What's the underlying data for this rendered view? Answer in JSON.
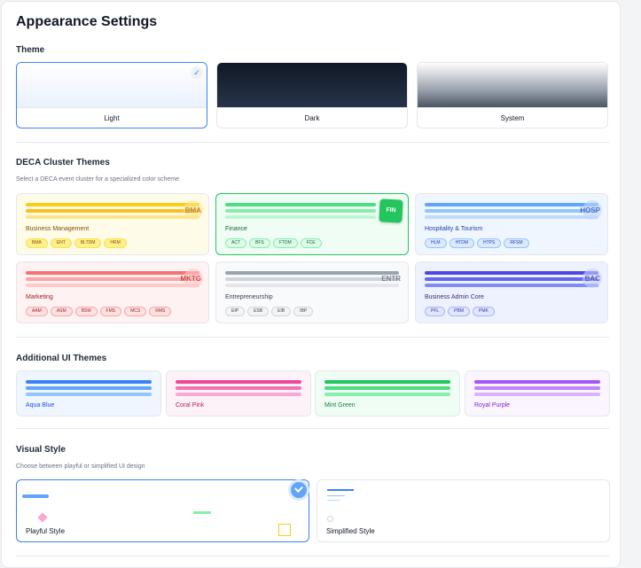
{
  "page": {
    "title": "Appearance Settings"
  },
  "theme": {
    "label": "Theme",
    "options": [
      {
        "label": "Light",
        "selected": true
      },
      {
        "label": "Dark",
        "selected": false
      },
      {
        "label": "System",
        "selected": false
      }
    ]
  },
  "clusters": {
    "label": "DECA Cluster Themes",
    "sub": "Select a DECA event cluster for a specialized color scheme",
    "items": [
      {
        "name": "Business Management",
        "abbr": "BMA",
        "tags": [
          "BMA",
          "ENT",
          "BLTDM",
          "HRM"
        ],
        "color": "#eab308",
        "selected": false
      },
      {
        "name": "Finance",
        "abbr": "FIN",
        "tags": [
          "ACT",
          "BFS",
          "FTDM",
          "FCE"
        ],
        "color": "#22c55e",
        "selected": true
      },
      {
        "name": "Hospitality & Tourism",
        "abbr": "HOSP",
        "tags": [
          "HLM",
          "HTDM",
          "HTPS",
          "RFSM"
        ],
        "color": "#3b82f6",
        "selected": false
      },
      {
        "name": "Marketing",
        "abbr": "MKTG",
        "tags": [
          "AAM",
          "ASM",
          "BSM",
          "FMS",
          "MCS",
          "RMS"
        ],
        "color": "#ef4444",
        "selected": false
      },
      {
        "name": "Entrepreneurship",
        "abbr": "ENTR",
        "tags": [
          "EIP",
          "ESB",
          "EIB",
          "IBP"
        ],
        "color": "#6b7280",
        "selected": false
      },
      {
        "name": "Business Admin Core",
        "abbr": "BAC",
        "tags": [
          "PFL",
          "PBM",
          "PMK"
        ],
        "color": "#4f46e5",
        "selected": false
      }
    ]
  },
  "additional": {
    "label": "Additional UI Themes",
    "items": [
      {
        "name": "Aqua Blue",
        "color": "#3b82f6"
      },
      {
        "name": "Coral Pink",
        "color": "#ec4899"
      },
      {
        "name": "Mint Green",
        "color": "#22c55e"
      },
      {
        "name": "Royal Purple",
        "color": "#a855f7"
      }
    ]
  },
  "visual": {
    "label": "Visual Style",
    "sub": "Choose between playful or simplified UI design",
    "options": [
      {
        "label": "Playful Style",
        "selected": true
      },
      {
        "label": "Simplified Style",
        "selected": false
      }
    ]
  }
}
